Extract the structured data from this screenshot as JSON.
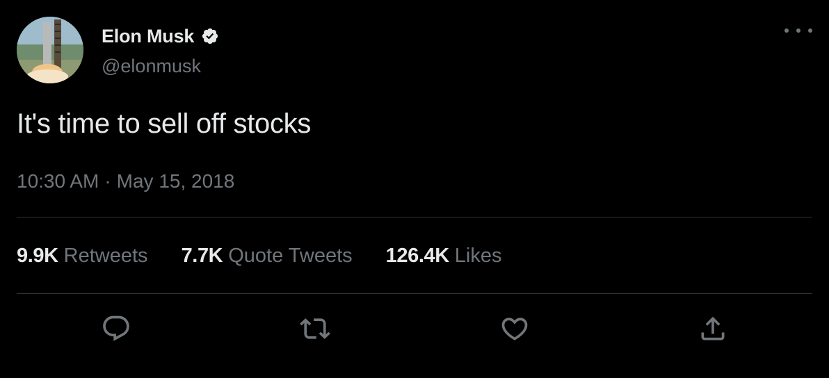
{
  "author": {
    "display_name": "Elon Musk",
    "handle": "@elonmusk",
    "verified_icon": "verified-badge-icon",
    "avatar_icon": "avatar-image"
  },
  "tweet": {
    "text": "It's time to sell off stocks",
    "time": "10:30 AM",
    "separator": "·",
    "date": "May 15, 2018"
  },
  "stats": [
    {
      "value": "9.9K",
      "label": "Retweets"
    },
    {
      "value": "7.7K",
      "label": "Quote Tweets"
    },
    {
      "value": "126.4K",
      "label": "Likes"
    }
  ],
  "actions": [
    "reply-icon",
    "retweet-icon",
    "like-icon",
    "share-icon"
  ],
  "colors": {
    "background": "#000000",
    "primary_text": "#e7e9ea",
    "secondary_text": "#71767b",
    "divider": "#2f3336"
  }
}
